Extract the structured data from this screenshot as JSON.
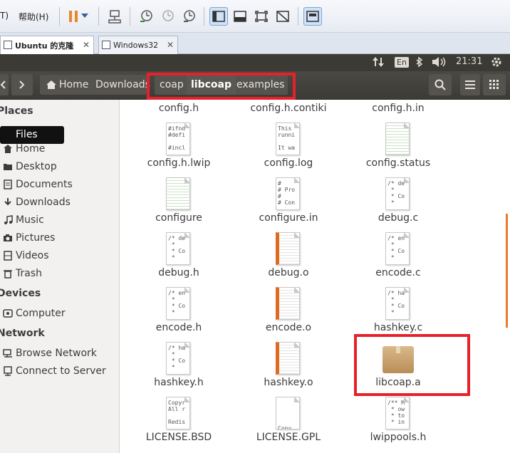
{
  "vmware": {
    "menu_left": "T)",
    "menu_help": "帮助(H)",
    "tabs": [
      {
        "label": "Ubuntu 的克隆",
        "close": "✕",
        "active": true
      },
      {
        "label": "Windows32",
        "close": "✕",
        "active": false
      }
    ],
    "icons": [
      "pause-icon",
      "dropdown-arrow-icon",
      "send-keys-icon",
      "snapshot-take-icon",
      "snapshot-revert-icon",
      "snapshot-manager-icon",
      "view-console-icon",
      "view-tabbed-icon",
      "fullscreen-icon",
      "unity-icon",
      "thumbnail-icon"
    ]
  },
  "panel": {
    "lang": "En",
    "time": "21:31"
  },
  "header": {
    "breadcrumbs": [
      {
        "label": "Home",
        "current": false
      },
      {
        "label": "Downloads",
        "current": false
      },
      {
        "label": "coap",
        "current": false
      },
      {
        "label": "libcoap",
        "current": true
      },
      {
        "label": "examples",
        "current": false
      }
    ]
  },
  "sidebar": {
    "tooltip": "Files",
    "sections": [
      {
        "title": "Places",
        "items": [
          "Home",
          "Desktop",
          "Documents",
          "Downloads",
          "Music",
          "Pictures",
          "Videos",
          "Trash"
        ]
      },
      {
        "title": "Devices",
        "items": [
          "Computer"
        ]
      },
      {
        "title": "Network",
        "items": [
          "Browse Network",
          "Connect to Server"
        ]
      }
    ]
  },
  "files": [
    {
      "name": "config.h",
      "kind": "partial"
    },
    {
      "name": "config.h.contiki",
      "kind": "partial"
    },
    {
      "name": "config.h.in",
      "kind": "partial"
    },
    {
      "name": "config.h.lwip",
      "kind": "text",
      "preview": "#ifnd\n#defi\n\n#incl"
    },
    {
      "name": "config.log",
      "kind": "text",
      "preview": "This\nrunni\n\nIt wa"
    },
    {
      "name": "config.status",
      "kind": "cfg"
    },
    {
      "name": "configure",
      "kind": "cfg"
    },
    {
      "name": "configure.in",
      "kind": "text",
      "preview": "#\n# Pro\n#\n# Con"
    },
    {
      "name": "debug.c",
      "kind": "text",
      "preview": "/* de\n *\n * Co\n *"
    },
    {
      "name": "debug.h",
      "kind": "text",
      "preview": "/* de\n *\n * Co\n *"
    },
    {
      "name": "debug.o",
      "kind": "obj"
    },
    {
      "name": "encode.c",
      "kind": "text",
      "preview": "/* en\n *\n * Co\n *"
    },
    {
      "name": "encode.h",
      "kind": "text",
      "preview": "/* en\n *\n * Co\n *"
    },
    {
      "name": "encode.o",
      "kind": "obj"
    },
    {
      "name": "hashkey.c",
      "kind": "text",
      "preview": "/* ha\n *\n * Co\n *"
    },
    {
      "name": "hashkey.h",
      "kind": "text",
      "preview": "/* ha\n *\n * Co\n *"
    },
    {
      "name": "hashkey.o",
      "kind": "obj"
    },
    {
      "name": "libcoap.a",
      "kind": "package"
    },
    {
      "name": "LICENSE.BSD",
      "kind": "text",
      "preview": "Copyr\nAll r\n\nRedis"
    },
    {
      "name": "LICENSE.GPL",
      "kind": "text",
      "preview": "\n\n\n\nCopy"
    },
    {
      "name": "lwippools.h",
      "kind": "text",
      "preview": "/** M\n * ow\n * to\n * in"
    }
  ],
  "colors": {
    "highlight": "#e5222b",
    "ubuntu_panel": "#3b3a35",
    "header_bar": "#43423e",
    "sidebar_bg": "#f2f1f0",
    "object_accent": "#e06b1f"
  }
}
